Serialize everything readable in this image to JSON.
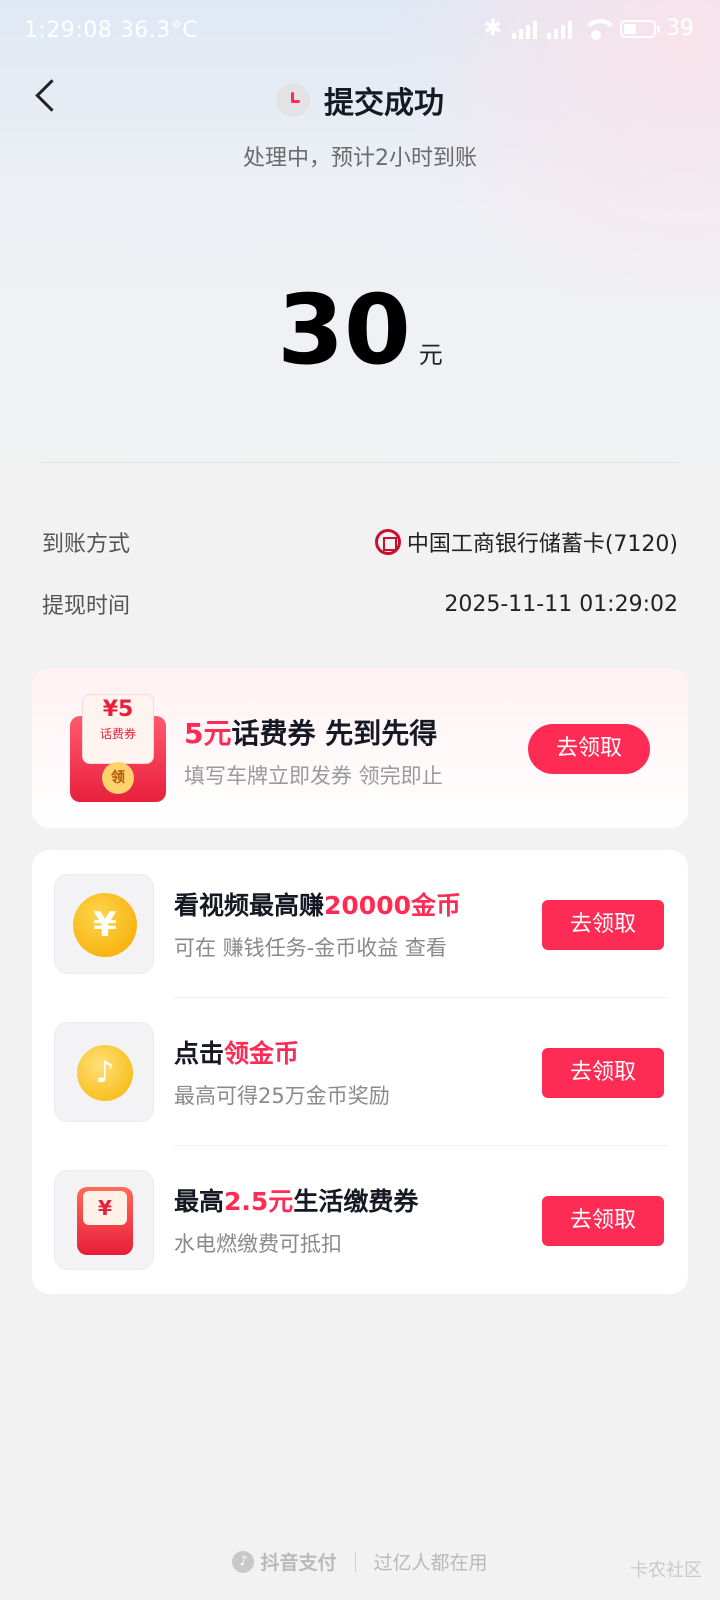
{
  "status_bar": {
    "time": "1:29:08",
    "temperature": "36.3°C",
    "battery_level": "39"
  },
  "header": {
    "title": "提交成功",
    "subtitle": "处理中，预计2小时到账"
  },
  "amount": {
    "value": "30",
    "unit": "元"
  },
  "details": [
    {
      "label": "到账方式",
      "value": "中国工商银行储蓄卡(7120)"
    },
    {
      "label": "提现时间",
      "value": "2025-11-11 01:29:02"
    }
  ],
  "promo": {
    "envelope_amount": "¥5",
    "envelope_label": "话费券",
    "envelope_coin": "领",
    "title_highlight": "5元",
    "title_rest": "话费券 先到先得",
    "subtitle": "填写车牌立即发券 领完即止",
    "button": "去领取"
  },
  "tasks": [
    {
      "name_prefix": "看视频最高赚",
      "name_highlight": "20000金币",
      "name_suffix": "",
      "desc": "可在 赚钱任务-金币收益 查看",
      "button": "去领取",
      "icon": "yen-coin-icon"
    },
    {
      "name_prefix": "点击",
      "name_highlight": "领金币",
      "name_suffix": "",
      "desc": "最高可得25万金币奖励",
      "button": "去领取",
      "icon": "douyin-coin-icon"
    },
    {
      "name_prefix": "最高",
      "name_highlight": "2.5元",
      "name_suffix": "生活缴费券",
      "desc": "水电燃缴费可抵扣",
      "button": "去领取",
      "icon": "red-packet-icon"
    }
  ],
  "footer": {
    "brand": "抖音支付",
    "slogan": "过亿人都在用"
  },
  "watermark": "卡农社区",
  "colors": {
    "accent": "#fe2c55",
    "bank": "#c8102e"
  }
}
